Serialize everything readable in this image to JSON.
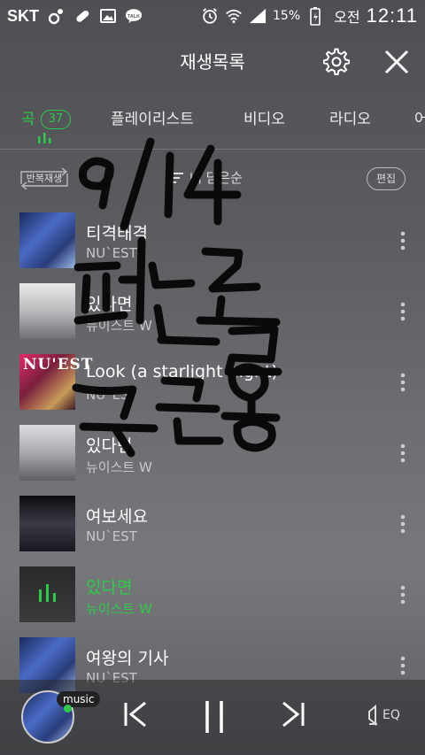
{
  "status_bar": {
    "carrier": "SKT",
    "battery_percent": "15%",
    "ampm": "오전",
    "time": "12:11"
  },
  "header": {
    "title": "재생목록"
  },
  "tabs": [
    {
      "label": "곡",
      "badge": "37",
      "active": true
    },
    {
      "label": "플레이리스트"
    },
    {
      "label": "비디오"
    },
    {
      "label": "라디오"
    },
    {
      "label": "어"
    }
  ],
  "toolbar": {
    "repeat_label": "반복재생",
    "sort_label": "내 담은순",
    "edit_label": "편집"
  },
  "songs": [
    {
      "title": "티격태격",
      "artist": "NU`EST"
    },
    {
      "title": "있다면",
      "artist": "뉴이스트 W"
    },
    {
      "title": "Look (a starlight night)",
      "artist": "NU`EST"
    },
    {
      "title": "있다면",
      "artist": "뉴이스트 W"
    },
    {
      "title": "여보세요",
      "artist": "NU`EST"
    },
    {
      "title": "있다면",
      "artist": "뉴이스트 W",
      "playing": true
    },
    {
      "title": "여왕의 기사",
      "artist": "NU`EST"
    }
  ],
  "album_art_text": "NU'EST",
  "mini_player": {
    "tag": "music",
    "eq_label": "EQ"
  },
  "handwriting": {
    "line1": "9/14",
    "line2": "피닌독",
    "line3": "구근용"
  },
  "accent_color": "#2ecb4a"
}
